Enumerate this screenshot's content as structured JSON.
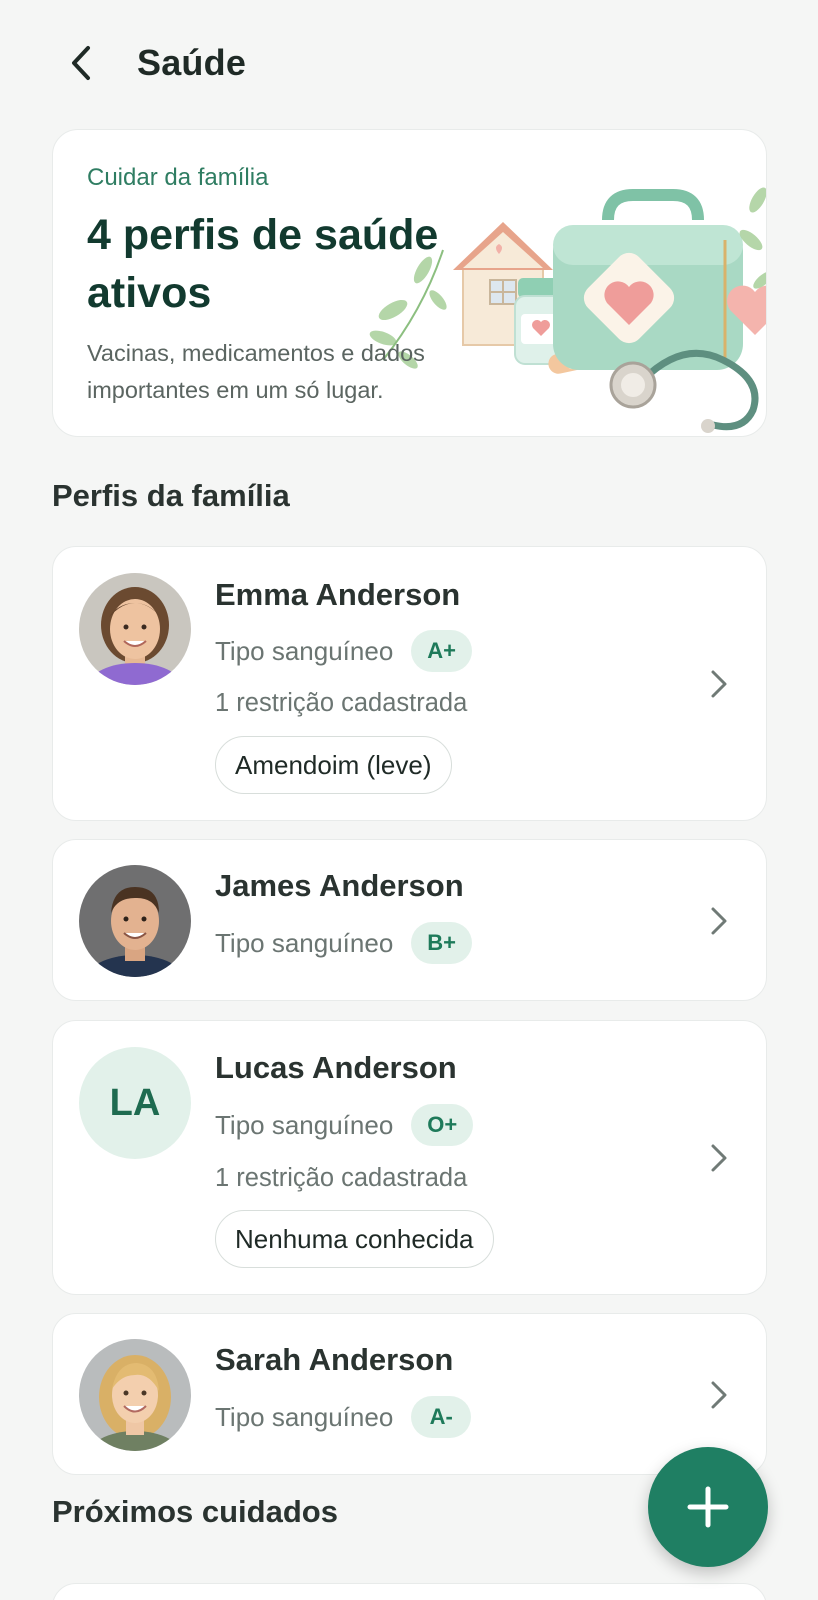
{
  "header": {
    "title": "Saúde",
    "back_icon": "chevron-left-icon"
  },
  "hero": {
    "eyebrow": "Cuidar da família",
    "title": "4 perfis de saúde ativos",
    "description": "Vacinas, medicamentos e dados importantes em um só lugar.",
    "illustration": "medical-bag-illustration"
  },
  "family_section": {
    "title": "Perfis da família"
  },
  "profiles": [
    {
      "name": "Emma Anderson",
      "blood_label": "Tipo sanguíneo",
      "blood_type": "A+",
      "restriction_count": "1 restrição cadastrada",
      "restriction": "Amendoim (leve)",
      "avatar": "photo"
    },
    {
      "name": "James Anderson",
      "blood_label": "Tipo sanguíneo",
      "blood_type": "B+",
      "avatar": "photo"
    },
    {
      "name": "Lucas Anderson",
      "blood_label": "Tipo sanguíneo",
      "blood_type": "O+",
      "restriction_count": "1 restrição cadastrada",
      "restriction": "Nenhuma conhecida",
      "avatar": "initials",
      "initials": "LA"
    },
    {
      "name": "Sarah Anderson",
      "blood_label": "Tipo sanguíneo",
      "blood_type": "A-",
      "avatar": "photo"
    }
  ],
  "upcoming_section": {
    "title": "Próximos cuidados"
  },
  "fab": {
    "icon": "plus-icon"
  },
  "colors": {
    "accent": "#1f7f63",
    "badge_bg": "#e2f1ea",
    "badge_text": "#1e7a5a",
    "background": "#f5f6f5"
  }
}
